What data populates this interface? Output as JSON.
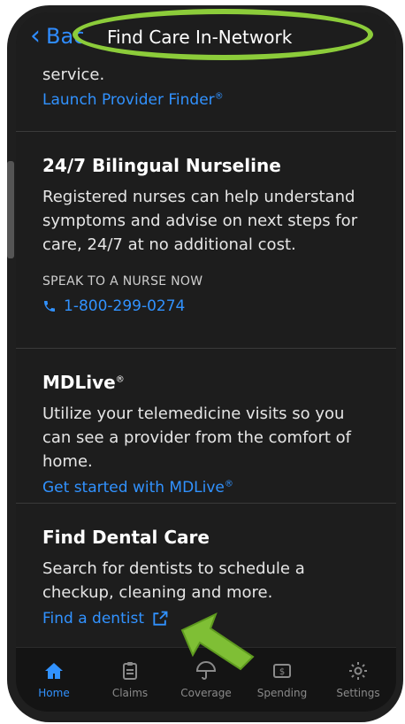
{
  "header": {
    "back_label": "Back",
    "title": "Find Care In-Network"
  },
  "sections": {
    "provider": {
      "tail_text": "service.",
      "link": "Launch Provider Finder",
      "link_mark": "®"
    },
    "nurseline": {
      "title": "24/7 Bilingual Nurseline",
      "body": "Registered nurses can help understand symptoms and advise on next steps for care, 24/7 at no additional cost.",
      "caption": "SPEAK TO A NURSE NOW",
      "phone": "1-800-299-0274"
    },
    "mdlive": {
      "title": "MDLive",
      "title_mark": "®",
      "body": "Utilize your telemedicine visits so you can see a provider from the comfort of home.",
      "link": "Get started with MDLive",
      "link_mark": "®"
    },
    "dental": {
      "title": "Find Dental Care",
      "body": "Search for dentists to schedule a checkup, cleaning and more.",
      "link": "Find a dentist"
    }
  },
  "tabs": [
    {
      "label": "Home",
      "icon": "home-icon",
      "active": true
    },
    {
      "label": "Claims",
      "icon": "clipboard-icon",
      "active": false
    },
    {
      "label": "Coverage",
      "icon": "umbrella-icon",
      "active": false
    },
    {
      "label": "Spending",
      "icon": "dollar-icon",
      "active": false
    },
    {
      "label": "Settings",
      "icon": "gear-icon",
      "active": false
    }
  ],
  "colors": {
    "accent": "#3192ff",
    "highlight": "#8ccc3a",
    "background": "#1d1d1d"
  }
}
